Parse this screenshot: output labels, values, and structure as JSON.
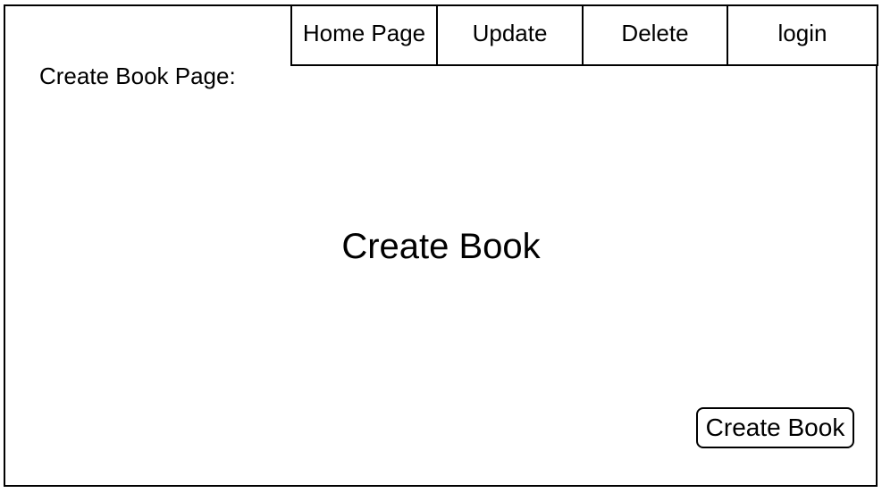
{
  "page": {
    "label": "Create Book Page:",
    "title": "Create Book"
  },
  "nav": {
    "tabs": [
      {
        "label": "Home Page"
      },
      {
        "label": "Update"
      },
      {
        "label": "Delete"
      },
      {
        "label": "login"
      }
    ]
  },
  "actions": {
    "create_button_label": "Create Book"
  }
}
